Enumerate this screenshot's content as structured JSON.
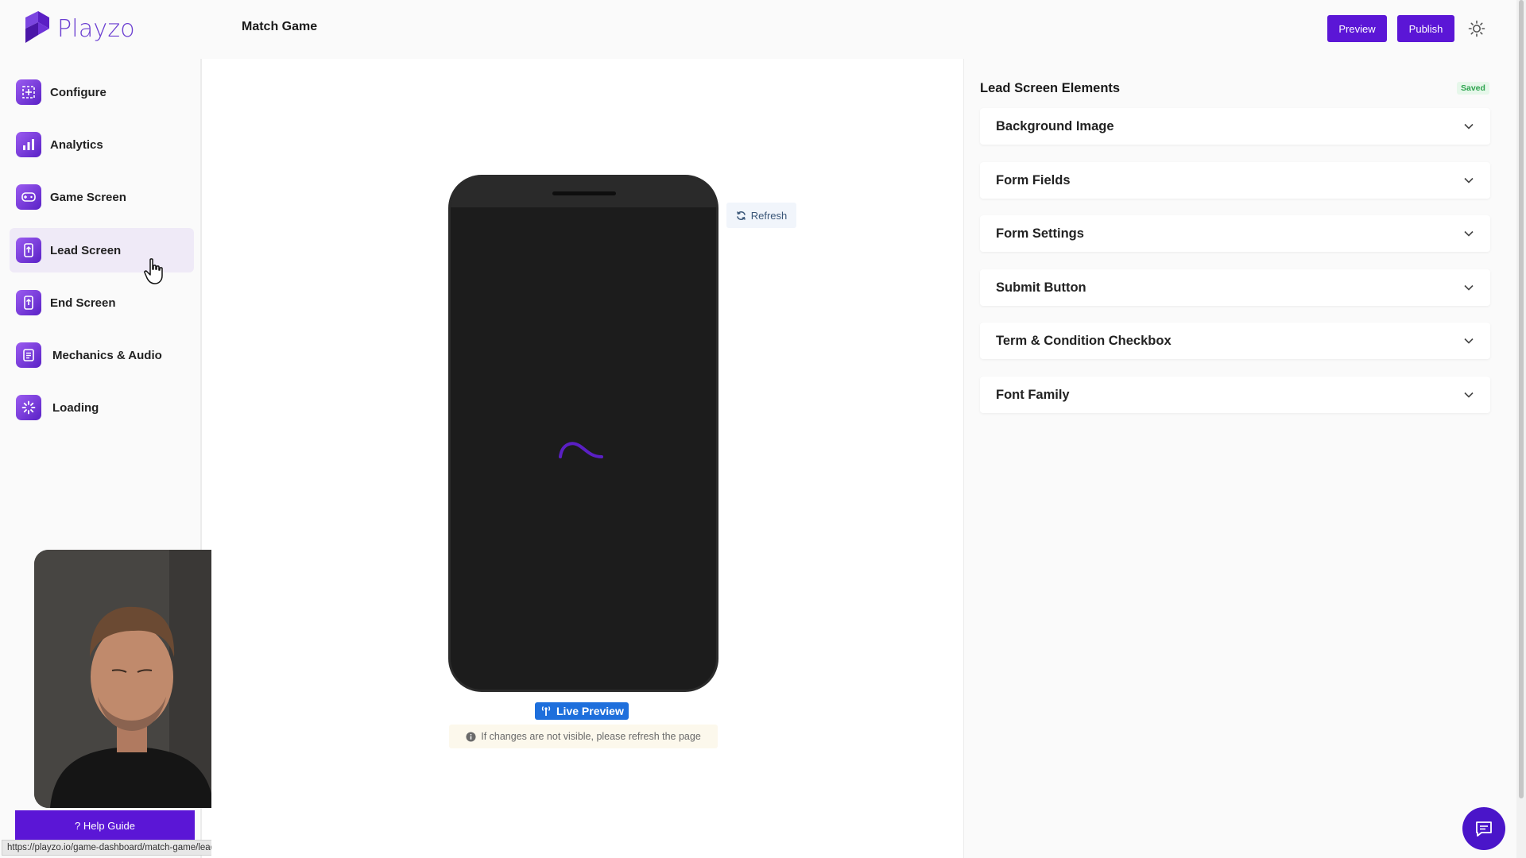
{
  "header": {
    "logo_text": "Playzo",
    "title": "Match Game",
    "preview_label": "Preview",
    "publish_label": "Publish"
  },
  "sidebar": {
    "items": [
      {
        "label": "Configure",
        "icon": "configure-icon",
        "active": false
      },
      {
        "label": "Analytics",
        "icon": "analytics-icon",
        "active": false
      },
      {
        "label": "Game Screen",
        "icon": "game-screen-icon",
        "active": false
      },
      {
        "label": "Lead Screen",
        "icon": "lead-screen-icon",
        "active": true
      },
      {
        "label": "End Screen",
        "icon": "end-screen-icon",
        "active": false
      },
      {
        "label": "Mechanics & Audio",
        "icon": "mechanics-audio-icon",
        "active": false
      },
      {
        "label": "Loading",
        "icon": "loading-icon",
        "active": false
      }
    ],
    "help_label": "? Help Guide"
  },
  "status_url": "https://playzo.io/game-dashboard/match-game/lead-screen/",
  "preview": {
    "refresh_label": "Refresh",
    "live_label": "Live Preview",
    "note": "If changes are not visible, please refresh the page"
  },
  "panel": {
    "title": "Lead Screen Elements",
    "saved_label": "Saved",
    "sections": [
      "Background Image",
      "Form Fields",
      "Form Settings",
      "Submit Button",
      "Term & Condition Checkbox",
      "Font Family"
    ]
  },
  "colors": {
    "brand": "#5b16d6",
    "logo": "#6b3fd1",
    "active_bg": "#efeaf7",
    "live_badge": "#1e6fdc",
    "saved": "#2ea44f"
  }
}
